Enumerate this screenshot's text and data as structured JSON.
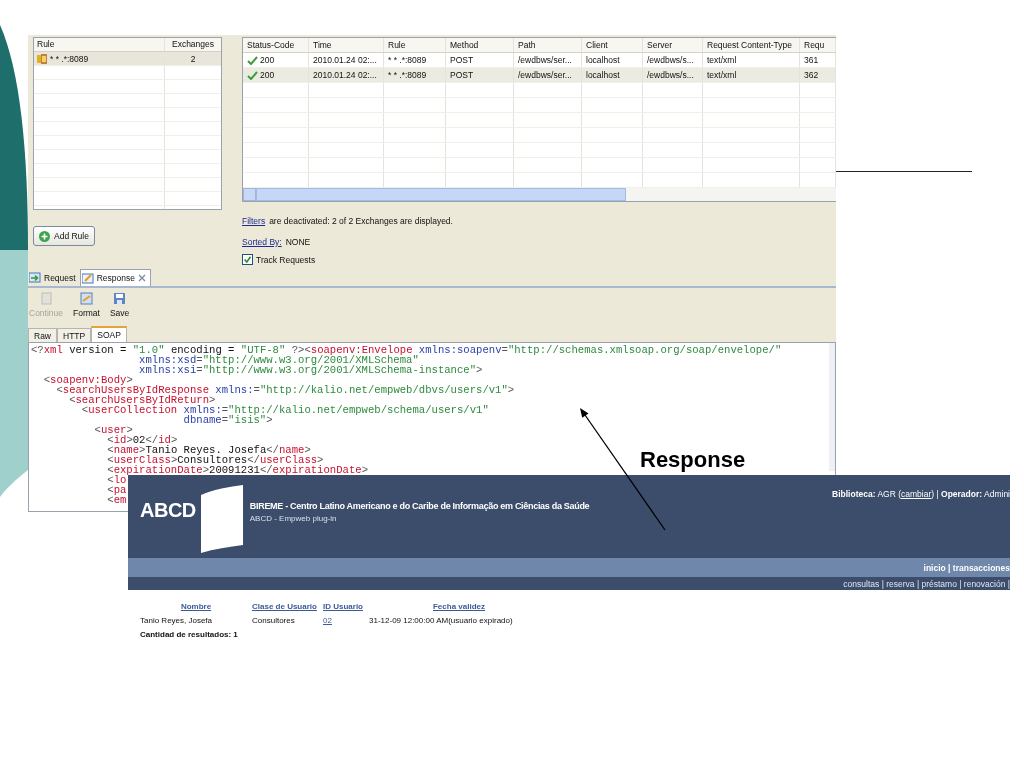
{
  "slide": {
    "label": "Response"
  },
  "proxy_window": {
    "rules_table": {
      "columns": [
        "Rule",
        "Exchanges"
      ],
      "rows": [
        {
          "rule": "* * .*:8089",
          "exchanges": "2",
          "selected": true
        }
      ]
    },
    "add_rule_button": "Add Rule",
    "exchanges_table": {
      "columns": [
        "Status-Code",
        "Time",
        "Rule",
        "Method",
        "Path",
        "Client",
        "Server",
        "Request Content-Type",
        "Requ"
      ],
      "rows": [
        {
          "cells": [
            "200",
            "2010.01.24 02:...",
            "* * .*:8089",
            "POST",
            "/ewdbws/ser...",
            "localhost",
            "/ewdbws/s...",
            "text/xml",
            "361"
          ],
          "selected": false
        },
        {
          "cells": [
            "200",
            "2010.01.24 02:...",
            "* * .*:8089",
            "POST",
            "/ewdbws/ser...",
            "localhost",
            "/ewdbws/s...",
            "text/xml",
            "362"
          ],
          "selected": true
        }
      ]
    },
    "filters": {
      "link": "Filters",
      "text": "are deactivated:  2 of 2 Exchanges are displayed."
    },
    "sorted_by": {
      "link": "Sorted By:",
      "value": "NONE"
    },
    "track_requests": {
      "label": "Track Requests",
      "checked": true
    },
    "tabs": [
      {
        "label": "Request",
        "kind": "request",
        "selected": false,
        "closable": false
      },
      {
        "label": "Response",
        "kind": "response",
        "selected": true,
        "closable": true
      }
    ],
    "toolbar": [
      {
        "label": "Continue",
        "kind": "continue",
        "disabled": true
      },
      {
        "label": "Format",
        "kind": "format",
        "disabled": false
      },
      {
        "label": "Save",
        "kind": "save",
        "disabled": false
      }
    ],
    "view_tabs": [
      {
        "label": "Raw",
        "selected": false
      },
      {
        "label": "HTTP",
        "selected": false
      },
      {
        "label": "SOAP",
        "selected": true
      }
    ],
    "xml_lines": [
      [
        {
          "kind": "punct",
          "text": "<?"
        },
        {
          "kind": "tag",
          "text": "xml"
        },
        {
          "kind": "plain",
          "text": " version = "
        },
        {
          "kind": "value",
          "text": "\"1.0\""
        },
        {
          "kind": "plain",
          "text": " encoding = "
        },
        {
          "kind": "value",
          "text": "\"UTF-8\""
        },
        {
          "kind": "punct",
          "text": " ?><"
        },
        {
          "kind": "tag",
          "text": "soapenv:Envelope"
        },
        {
          "kind": "attribute",
          "text": " xmlns:soapenv"
        },
        {
          "kind": "punct",
          "text": "="
        },
        {
          "kind": "value",
          "text": "\"http://schemas.xmlsoap.org/soap/envelope/\""
        }
      ],
      [
        {
          "kind": "attribute",
          "text": "                 xmlns:xsd"
        },
        {
          "kind": "punct",
          "text": "="
        },
        {
          "kind": "value",
          "text": "\"http://www.w3.org/2001/XMLSchema\""
        }
      ],
      [
        {
          "kind": "attribute",
          "text": "                 xmlns:xsi"
        },
        {
          "kind": "punct",
          "text": "="
        },
        {
          "kind": "value",
          "text": "\"http://www.w3.org/2001/XMLSchema-instance\""
        },
        {
          "kind": "punct",
          "text": ">"
        }
      ],
      [
        {
          "kind": "punct",
          "text": "  <"
        },
        {
          "kind": "tag",
          "text": "soapenv:Body"
        },
        {
          "kind": "punct",
          "text": ">"
        }
      ],
      [
        {
          "kind": "punct",
          "text": "    <"
        },
        {
          "kind": "tag",
          "text": "searchUsersByIdResponse"
        },
        {
          "kind": "attribute",
          "text": " xmlns:"
        },
        {
          "kind": "punct",
          "text": "="
        },
        {
          "kind": "value",
          "text": "\"http://kalio.net/empweb/dbvs/users/v1\""
        },
        {
          "kind": "punct",
          "text": ">"
        }
      ],
      [
        {
          "kind": "punct",
          "text": "      <"
        },
        {
          "kind": "tag",
          "text": "searchUsersByIdReturn"
        },
        {
          "kind": "punct",
          "text": ">"
        }
      ],
      [
        {
          "kind": "punct",
          "text": "        <"
        },
        {
          "kind": "tag",
          "text": "userCollection"
        },
        {
          "kind": "attribute",
          "text": " xmlns:"
        },
        {
          "kind": "punct",
          "text": "="
        },
        {
          "kind": "value",
          "text": "\"http://kalio.net/empweb/schema/users/v1\""
        }
      ],
      [
        {
          "kind": "attribute",
          "text": "                        dbname"
        },
        {
          "kind": "punct",
          "text": "="
        },
        {
          "kind": "value",
          "text": "\"isis\""
        },
        {
          "kind": "punct",
          "text": ">"
        }
      ],
      [
        {
          "kind": "punct",
          "text": "          <"
        },
        {
          "kind": "tag",
          "text": "user"
        },
        {
          "kind": "punct",
          "text": ">"
        }
      ],
      [
        {
          "kind": "punct",
          "text": "            <"
        },
        {
          "kind": "tag",
          "text": "id"
        },
        {
          "kind": "punct",
          "text": ">"
        },
        {
          "kind": "plain",
          "text": "02"
        },
        {
          "kind": "punct",
          "text": "</"
        },
        {
          "kind": "tag",
          "text": "id"
        },
        {
          "kind": "punct",
          "text": ">"
        }
      ],
      [
        {
          "kind": "punct",
          "text": "            <"
        },
        {
          "kind": "tag",
          "text": "name"
        },
        {
          "kind": "punct",
          "text": ">"
        },
        {
          "kind": "plain",
          "text": "Tanio Reyes. Josefa"
        },
        {
          "kind": "punct",
          "text": "</"
        },
        {
          "kind": "tag",
          "text": "name"
        },
        {
          "kind": "punct",
          "text": ">"
        }
      ],
      [
        {
          "kind": "punct",
          "text": "            <"
        },
        {
          "kind": "tag",
          "text": "userClass"
        },
        {
          "kind": "punct",
          "text": ">"
        },
        {
          "kind": "plain",
          "text": "Consultores"
        },
        {
          "kind": "punct",
          "text": "</"
        },
        {
          "kind": "tag",
          "text": "userClass"
        },
        {
          "kind": "punct",
          "text": ">"
        }
      ],
      [
        {
          "kind": "punct",
          "text": "            <"
        },
        {
          "kind": "tag",
          "text": "expirationDate"
        },
        {
          "kind": "punct",
          "text": ">"
        },
        {
          "kind": "plain",
          "text": "20091231"
        },
        {
          "kind": "punct",
          "text": "</"
        },
        {
          "kind": "tag",
          "text": "expirationDate"
        },
        {
          "kind": "punct",
          "text": ">"
        }
      ],
      [
        {
          "kind": "punct",
          "text": "            <"
        },
        {
          "kind": "tag",
          "text": "lo"
        }
      ],
      [
        {
          "kind": "punct",
          "text": "            <"
        },
        {
          "kind": "tag",
          "text": "pa"
        }
      ],
      [
        {
          "kind": "punct",
          "text": "            <"
        },
        {
          "kind": "tag",
          "text": "em"
        }
      ]
    ]
  },
  "abcd_page": {
    "logo": "ABCD",
    "title": "BIREME - Centro Latino Americano e do Caribe de Informação em Ciências da Saúde",
    "subtitle": "ABCD - Empweb plug-in",
    "session": {
      "before": "**Biblioteca:** AGR (",
      "link": "cambiar",
      "after": ") | **Operador:** Admini"
    },
    "main_nav": "inicio | transacciones",
    "sub_nav": "consultas | reserva | préstamo | renovación |",
    "results": {
      "columns": [
        "Nombre",
        "Clase de Usuario",
        "ID Usuario",
        "Fecha validez"
      ],
      "rows": [
        [
          {
            "kind": "text",
            "text": "Tanio Reyes, Josefa"
          },
          {
            "kind": "text",
            "text": "Consultores"
          },
          {
            "kind": "link",
            "text": "02"
          },
          {
            "kind": "text",
            "text": "31-12-09 12:00:00 AM(usuario expirado)"
          }
        ]
      ],
      "count": "Cantidad de resultados: 1"
    }
  }
}
